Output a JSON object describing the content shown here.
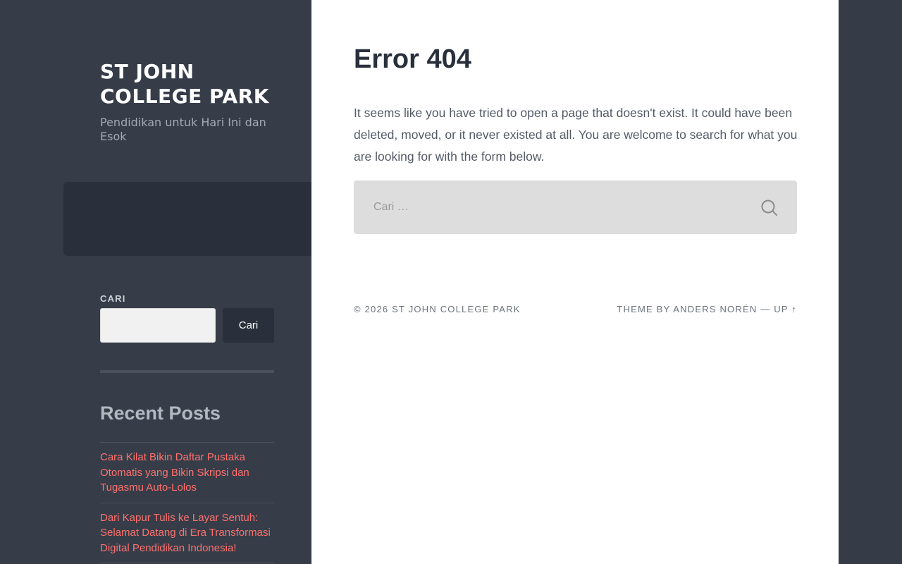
{
  "sidebar": {
    "site_title": "ST JOHN COLLEGE PARK",
    "site_description": "Pendidikan untuk Hari Ini dan Esok",
    "search_widget": {
      "title": "CARI",
      "input_value": "",
      "button_label": "Cari"
    },
    "recent_posts": {
      "title": "Recent Posts",
      "items": [
        {
          "label": "Cara Kilat Bikin Daftar Pustaka Otomatis yang Bikin Skripsi dan Tugasmu Auto-Lolos"
        },
        {
          "label": "Dari Kapur Tulis ke Layar Sentuh: Selamat Datang di Era Transformasi Digital Pendidikan Indonesia!"
        }
      ]
    }
  },
  "main": {
    "title": "Error 404",
    "message": "It seems like you have tried to open a page that doesn't exist. It could have been deleted, moved, or it never existed at all. You are welcome to search for what you are looking for with the form below.",
    "search": {
      "placeholder": "Cari …",
      "icon": "search-icon"
    }
  },
  "footer": {
    "copyright": "© 2026",
    "site_link": "ST JOHN COLLEGE PARK",
    "theme_by": "THEME BY",
    "author": "ANDERS NORÉN",
    "separator": "—",
    "up_link": "UP ↑"
  },
  "colors": {
    "sidebar_bg": "#363d49",
    "content_bg": "#ffffff",
    "accent_link": "#ff706c",
    "dark_text": "#29303b"
  }
}
